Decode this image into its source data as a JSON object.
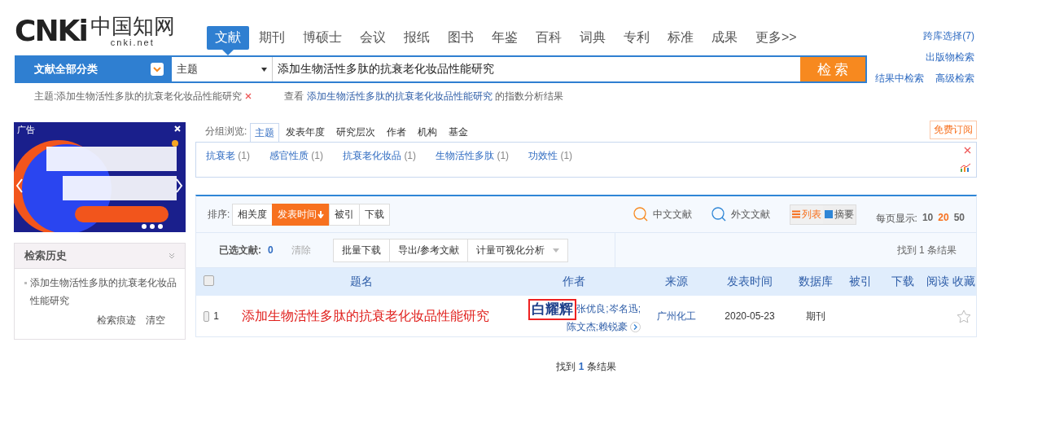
{
  "logo": {
    "mark": "CNKi",
    "chinese": "中国知网",
    "domain": "cnki.net"
  },
  "nav": [
    {
      "label": "文献",
      "selected": true
    },
    {
      "label": "期刊",
      "selected": false
    },
    {
      "label": "博硕士",
      "selected": false
    },
    {
      "label": "会议",
      "selected": false
    },
    {
      "label": "报纸",
      "selected": false
    },
    {
      "label": "图书",
      "selected": false
    },
    {
      "label": "年鉴",
      "selected": false
    },
    {
      "label": "百科",
      "selected": false
    },
    {
      "label": "词典",
      "selected": false
    },
    {
      "label": "专利",
      "selected": false
    },
    {
      "label": "标准",
      "selected": false
    },
    {
      "label": "成果",
      "selected": false
    },
    {
      "label": "更多>>",
      "selected": false
    }
  ],
  "right_links": [
    [
      "跨库选择(7)"
    ],
    [
      "出版物检索"
    ],
    [
      "结果中检索",
      "高级检索"
    ]
  ],
  "search": {
    "category": "文献全部分类",
    "field": "主题",
    "value": "添加生物活性多肽的抗衰老化妆品性能研究",
    "button": "检 索"
  },
  "crumb": {
    "label": "主题:添加生物活性多肽的抗衰老化妆品性能研究",
    "prefix": "查看",
    "link": "添加生物活性多肽的抗衰老化妆品性能研究",
    "suffix": "的指数分析结果"
  },
  "ad": {
    "label": "广告"
  },
  "history": {
    "title": "检索历史",
    "items": [
      "添加生物活性多肽的抗衰老化妆品性能研究"
    ],
    "actions": [
      "检索痕迹",
      "清空"
    ]
  },
  "group": {
    "label": "分组浏览:",
    "tabs": [
      {
        "label": "主题",
        "selected": true
      },
      {
        "label": "发表年度",
        "selected": false
      },
      {
        "label": "研究层次",
        "selected": false
      },
      {
        "label": "作者",
        "selected": false
      },
      {
        "label": "机构",
        "selected": false
      },
      {
        "label": "基金",
        "selected": false
      }
    ],
    "subscribe": "免费订阅",
    "items": [
      {
        "label": "抗衰老",
        "count": "(1)"
      },
      {
        "label": "感官性质",
        "count": "(1)"
      },
      {
        "label": "抗衰老化妆品",
        "count": "(1)"
      },
      {
        "label": "生物活性多肽",
        "count": "(1)"
      },
      {
        "label": "功效性",
        "count": "(1)"
      }
    ]
  },
  "sort": {
    "label": "排序:",
    "options": [
      {
        "label": "相关度",
        "selected": false
      },
      {
        "label": "发表时间",
        "selected": true
      },
      {
        "label": "被引",
        "selected": false
      },
      {
        "label": "下载",
        "selected": false
      }
    ],
    "langs": [
      "中文文献",
      "外文文献"
    ],
    "views": [
      {
        "label": "列表",
        "selected": true
      },
      {
        "label": "摘要",
        "selected": false
      }
    ],
    "per_page_label": "每页显示:",
    "per_page": [
      {
        "label": "10",
        "selected": false
      },
      {
        "label": "20",
        "selected": true
      },
      {
        "label": "50",
        "selected": false
      }
    ]
  },
  "selection": {
    "label": "已选文献:",
    "count": "0",
    "clear": "清除",
    "actions": [
      "批量下载",
      "导出/参考文献",
      "计量可视化分析"
    ],
    "found": "找到 1 条结果"
  },
  "table": {
    "columns": [
      "题名",
      "作者",
      "来源",
      "发表时间",
      "数据库",
      "被引",
      "下载",
      "阅读",
      "收藏"
    ],
    "all_checked": false,
    "rows": [
      {
        "index": "1",
        "checked": false,
        "title": "添加生物活性多肽的抗衰老化妆品性能研究",
        "authors": [
          {
            "name": "白耀辉",
            "highlighted": true
          },
          {
            "name": "张优良;",
            "highlighted": false
          },
          {
            "name": "岑名迅;",
            "highlighted": false
          },
          {
            "name": "陈文杰;",
            "highlighted": false
          },
          {
            "name": "赖锐豪",
            "highlighted": false
          }
        ],
        "source": "广州化工",
        "date": "2020-05-23",
        "database": "期刊",
        "favorite": false
      }
    ]
  },
  "footer": {
    "prefix": "找到",
    "count": "1",
    "suffix": "条结果"
  }
}
